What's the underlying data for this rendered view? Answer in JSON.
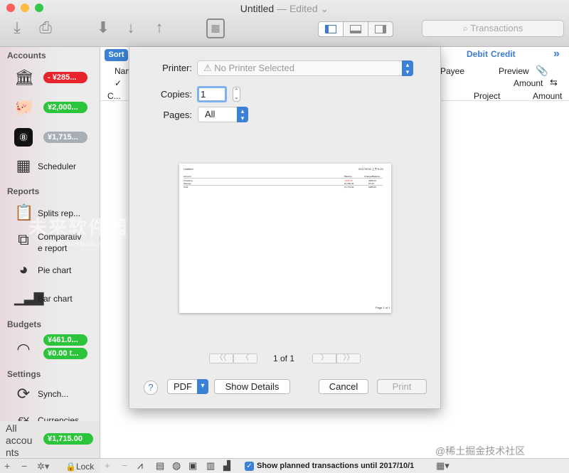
{
  "window": {
    "title": "Untitled",
    "edited_label": "— Edited ⌄"
  },
  "traffic_lights": {
    "close": "#fc605c",
    "minimize": "#fdbc40",
    "zoom": "#34c84a"
  },
  "toolbar": {
    "search_placeholder": "Transactions"
  },
  "sidebar": {
    "accounts_header": "Accounts",
    "accounts": [
      {
        "icon": "bank-icon",
        "balance": "- ¥285...",
        "color": "#e8232b"
      },
      {
        "icon": "piggy-bank-icon",
        "balance": "¥2,000...",
        "color": "#2bc43a"
      },
      {
        "icon": "eight-ball-icon",
        "balance": "¥1,715...",
        "color": "#a8aeb6"
      }
    ],
    "scheduler_label": "Scheduler",
    "reports_header": "Reports",
    "reports": [
      {
        "icon": "clipboard-icon",
        "label": "Splits rep..."
      },
      {
        "icon": "compare-icon",
        "label": "Comparativ\ne report"
      },
      {
        "icon": "pie-chart-icon",
        "label": "Pie chart"
      },
      {
        "icon": "bar-chart-icon",
        "label": "Bar chart"
      }
    ],
    "budgets_header": "Budgets",
    "budget_values": [
      "¥461.0...",
      "¥0.00 t..."
    ],
    "budget_color": "#2bc43a",
    "settings_header": "Settings",
    "settings": [
      {
        "icon": "sync-icon",
        "label": "Synch..."
      },
      {
        "icon": "currency-icon",
        "label": "Currencies"
      }
    ],
    "all_accounts_label": "All\naccou\nnts",
    "all_accounts_value": "¥1,715.00",
    "lock_label": "Lock"
  },
  "main": {
    "sort_button": "Sort",
    "col_debit": "Debit",
    "col_credit": "Credit",
    "col_name": "Nam",
    "col_check": "✓",
    "col_c": "C...",
    "col_payee": "Payee",
    "col_preview": "Preview",
    "col_amount1": "Amount",
    "col_project": "Project",
    "col_amount2": "Amount",
    "show_planned": "Show planned transactions until 2017/10/1"
  },
  "print_dialog": {
    "printer_label": "Printer:",
    "printer_value": "No Printer Selected",
    "copies_label": "Copies:",
    "copies_value": "1",
    "pages_label": "Pages:",
    "pages_value": "All",
    "page_indicator": "1 of 1",
    "help": "?",
    "pdf_button": "PDF",
    "show_details": "Show Details",
    "cancel": "Cancel",
    "print": "Print",
    "preview": {
      "title": "Untitled",
      "date": "2017/9/30 上午9:29",
      "col_account": "Account",
      "col_balance": "Balance",
      "col_change": "Change/Balance",
      "rows": [
        {
          "name": "Checking",
          "balance": "-¥285.00",
          "change": "¥285.00"
        },
        {
          "name": "Savings",
          "balance": "¥2,000.00",
          "change": "¥0.00"
        }
      ],
      "total_label": "Total",
      "total_balance": "¥1,715.00",
      "total_change": "¥285.00",
      "page_footer": "Page 1 of 1"
    }
  },
  "watermark": {
    "line1": "未来软件园",
    "line2": "www.orsoon.com"
  },
  "corner_watermark": "@稀土掘金技术社区"
}
